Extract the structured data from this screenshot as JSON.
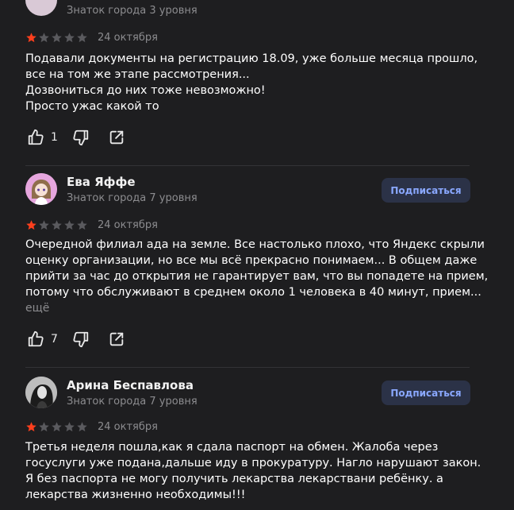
{
  "reviews": [
    {
      "author": "",
      "level": "Знаток города 3 уровня",
      "rating": 1,
      "date": "24 октября",
      "lines": [
        "Подавали документы на регистрацию 18.09, уже больше месяца прошло,",
        "все на том же этапе рассмотрения...",
        "Дозвониться до них тоже невозможно!",
        "Просто ужас какой то"
      ],
      "more": "",
      "likes": "1"
    },
    {
      "author": "Ева Яффе",
      "level": "Знаток города 7 уровня",
      "subscribe": "Подписаться",
      "rating": 1,
      "date": "24 октября",
      "lines": [
        "Очередной филиал ада на земле. Все настолько плохо, что Яндекс скрыли",
        "оценку организации, но все мы всё прекрасно понимаем... В общем даже",
        "прийти за час до открытия не гарантирует вам, что вы попадете на прием,",
        "потому что обслуживают в среднем около 1 человека в 40 минут, прием..."
      ],
      "more": "ещё",
      "likes": "7"
    },
    {
      "author": "Арина Беспавлова",
      "level": "Знаток города 7 уровня",
      "subscribe": "Подписаться",
      "rating": 1,
      "date": "24 октября",
      "lines": [
        "Третья неделя пошла,как я сдала паспорт на обмен. Жалоба через",
        "госуслуги уже подана,дальше иду в прокуратуру. Нагло нарушают закон.",
        "Я без паспорта не могу получить лекарства лекарствани ребёнку. а",
        "лекарства жизненно необходимы!!!"
      ]
    }
  ],
  "icons": {
    "like": "thumbs-up-icon",
    "dislike": "thumbs-down-icon",
    "share": "share-icon"
  },
  "colors": {
    "background": "#1e1e20",
    "star_filled": "#fc3f1d",
    "star_empty": "#5a5a5e",
    "subscribe_bg": "#2b3247",
    "subscribe_text": "#8aa8ff",
    "muted_text": "#8c8c8f"
  }
}
